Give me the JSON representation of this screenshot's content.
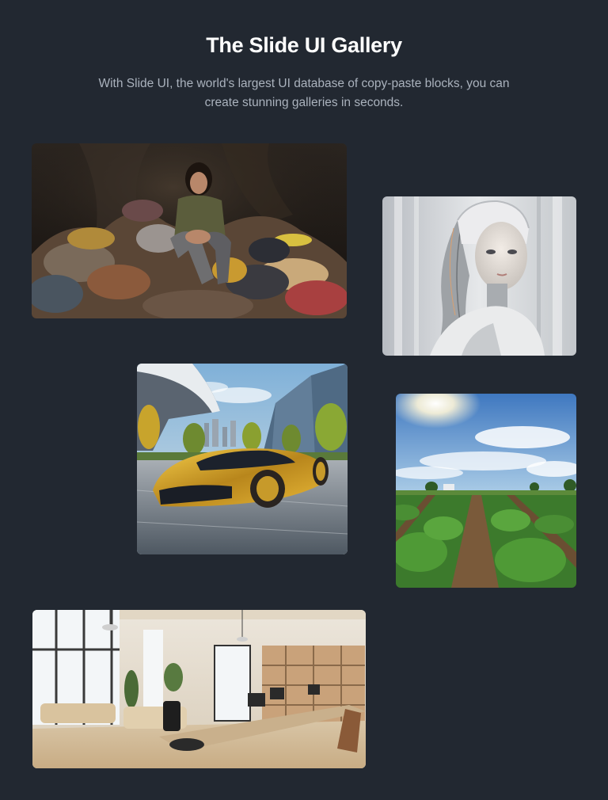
{
  "header": {
    "title": "The Slide UI Gallery",
    "subtitle": "With Slide UI, the world's largest UI database of copy-paste blocks, you can create stunning galleries in seconds."
  },
  "gallery": {
    "images": [
      {
        "subject": "woman sitting on a pile of clothes"
      },
      {
        "subject": "white humanoid robot portrait"
      },
      {
        "subject": "golden futuristic sports car"
      },
      {
        "subject": "green crop field under blue sky"
      },
      {
        "subject": "bright open-plan office interior"
      }
    ]
  },
  "colors": {
    "background": "#222831",
    "title": "#ffffff",
    "subtitle": "#aab2bd"
  }
}
